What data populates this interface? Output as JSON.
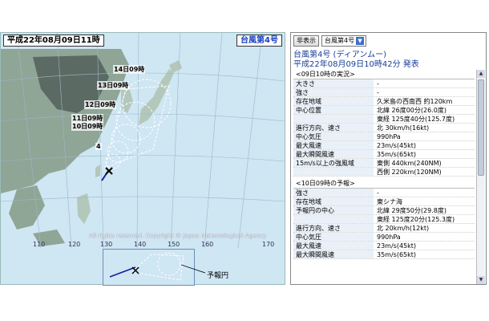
{
  "map": {
    "title": "平成22年08月09日11時",
    "storm_badge": "台風第4号",
    "copyright": "All rights reserved. Copyright © Japan Meteorological Agency",
    "lon_labels": [
      "110",
      "120",
      "130",
      "140",
      "150",
      "160",
      "170"
    ],
    "track_labels": {
      "t14": "14日09時",
      "t13": "13日09時",
      "t12": "12日09時",
      "t11": "11日09時",
      "t10": "10日09時",
      "current_number": "4"
    },
    "colors": {
      "sea": "#cfe6f3",
      "land_dark": "#5b6a63",
      "land_mid": "#8fa596",
      "land_light": "#b4c7bb",
      "track": "#1a1a99"
    }
  },
  "legend": {
    "label": "予報円"
  },
  "controls": {
    "hide_button": "非表示",
    "storm_select": "台風第4号"
  },
  "info": {
    "storm_name": "台風第4号 (ディアンムー)",
    "issued": "平成22年08月09日10時42分 発表",
    "current": {
      "heading": "<09日10時の実況>",
      "rows": [
        {
          "k": "大きさ",
          "v": "-"
        },
        {
          "k": "強さ",
          "v": "-"
        },
        {
          "k": "存在地域",
          "v": "久米島の西南西 約120km"
        },
        {
          "k": "中心位置",
          "v": "北緯 26度00分(26.0度)"
        },
        {
          "k": "",
          "v": "東経 125度40分(125.7度)"
        },
        {
          "k": "進行方向、速さ",
          "v": "北 30km/h(16kt)"
        },
        {
          "k": "中心気圧",
          "v": "990hPa"
        },
        {
          "k": "最大風速",
          "v": "23m/s(45kt)"
        },
        {
          "k": "最大瞬間風速",
          "v": "35m/s(65kt)"
        },
        {
          "k": "15m/s以上の強風域",
          "v": "東側 440km(240NM)"
        },
        {
          "k": "",
          "v": "西側 220km(120NM)"
        }
      ]
    },
    "forecast": {
      "heading": "<10日09時の予報>",
      "rows": [
        {
          "k": "強さ",
          "v": "-"
        },
        {
          "k": "存在地域",
          "v": "東シナ海"
        },
        {
          "k": "予報円の中心",
          "v": "北緯 29度50分(29.8度)"
        },
        {
          "k": "",
          "v": "東経 125度20分(125.3度)"
        },
        {
          "k": "進行方向、速さ",
          "v": "北 20km/h(12kt)"
        },
        {
          "k": "中心気圧",
          "v": "990hPa"
        },
        {
          "k": "最大風速",
          "v": "23m/s(45kt)"
        },
        {
          "k": "最大瞬間風速",
          "v": "35m/s(65kt)"
        }
      ]
    }
  }
}
